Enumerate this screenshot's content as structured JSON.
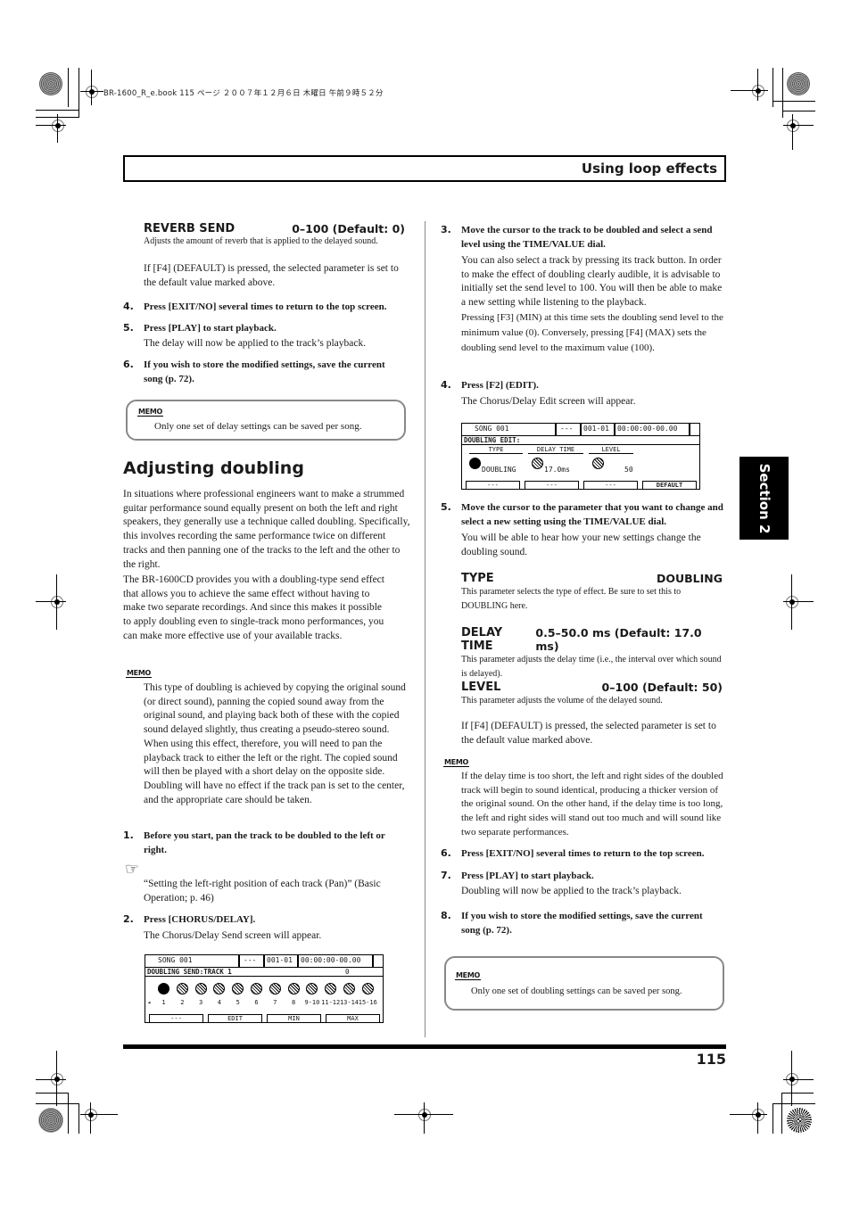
{
  "print_header": "BR-1600_R_e.book  115 ページ  ２００７年１２月６日  木曜日  午前９時５２分",
  "header": {
    "title": "Using loop effects"
  },
  "section_tab": "Section 2",
  "page_number": "115",
  "left": {
    "reverb_send": {
      "name": "REVERB SEND",
      "range": "0–100 (Default: 0)",
      "desc": "Adjusts the amount of reverb that is applied to the delayed sound."
    },
    "default_note": "If [F4] (DEFAULT) is pressed, the selected parameter is set to the default value marked above.",
    "steps_a": [
      {
        "num": "4.",
        "text": "Press [EXIT/NO] several times to return to the top screen.",
        "sub": ""
      },
      {
        "num": "5.",
        "text": "Press [PLAY] to start playback.",
        "sub": "The delay will now be applied to the track’s playback."
      },
      {
        "num": "6.",
        "text": "If you wish to store the modified settings, save the current song (p. 72).",
        "sub": ""
      }
    ],
    "memo1": {
      "icon": "MEMO",
      "text": "Only one set of delay settings can be saved per song."
    },
    "heading": "Adjusting doubling",
    "intro1": "In situations where professional engineers want to make a strummed guitar performance sound equally present on both the left and right speakers, they generally use a technique called doubling. Specifically, this involves recording the same performance twice on different tracks and then panning one of the tracks to the left and the other to the right.",
    "intro2": "The BR-1600CD provides you with a doubling-type send effect that allows you to achieve the same effect without having to make two separate recordings. And since this makes it possible to apply doubling even to single-track mono performances, you can make more effective use of your available tracks.",
    "memo2": {
      "icon": "MEMO",
      "text": "This type of doubling is achieved by copying the original sound (or direct sound), panning the copied sound away from the original sound, and playing back both of these with the copied sound delayed slightly, thus creating a pseudo-stereo sound. When using this effect, therefore, you will need to pan the playback track to either the left or the right. The copied sound will then be played with a short delay on the opposite side. Doubling will have no effect if the track pan is set to the center, and the appropriate care should be taken."
    },
    "step1": {
      "num": "1.",
      "text": "Before you start, pan the track to be doubled to the left or right."
    },
    "ref": {
      "icon": "☞",
      "text": "“Setting the left-right position of each track (Pan)” (Basic Operation; p. 46)"
    },
    "step2": {
      "num": "2.",
      "text": "Press [CHORUS/DELAY].",
      "sub": "The Chorus/Delay Send screen will appear."
    }
  },
  "screen_send": {
    "song": "SONG  001",
    "measure_blank": "---",
    "measure": "001-01",
    "time": "00:00:00-00.00",
    "title": "DOUBLING SEND:TRACK  1",
    "value": "0",
    "tracks": [
      "1",
      "2",
      "3",
      "4",
      "5",
      "6",
      "7",
      "8",
      "9-10",
      "11-12",
      "13-14",
      "15-16"
    ],
    "arrow": "◂",
    "fkeys": [
      "---",
      "EDIT",
      "MIN",
      "MAX"
    ]
  },
  "right": {
    "step3": {
      "num": "3.",
      "text": "Move the cursor to the track to be doubled and select a send level using the TIME/VALUE dial.",
      "sub1": "You can also select a track by pressing its track button. In order to make the effect of doubling clearly audible, it is advisable to initially set the send level to 100. You will then be able to make a new setting while listening to the playback.",
      "sub2": "Pressing [F3] (MIN) at this time sets the doubling send level to the minimum value (0). Conversely, pressing [F4] (MAX) sets the doubling send level to the maximum value (100)."
    },
    "step4": {
      "num": "4.",
      "text": "Press [F2] (EDIT).",
      "sub": "The Chorus/Delay Edit screen will appear."
    },
    "step5": {
      "num": "5.",
      "text": "Move the cursor to the parameter that you want to change and select a new setting using the TIME/VALUE dial.",
      "sub": "You will be able to hear how your new settings change the doubling sound."
    },
    "params": [
      {
        "name": "TYPE",
        "range": "DOUBLING",
        "desc": "This parameter selects the type of effect. Be sure to set this to DOUBLING here."
      },
      {
        "name": "DELAY TIME",
        "range": "0.5–50.0 ms (Default: 17.0 ms)",
        "desc": "This parameter adjusts the delay time (i.e., the interval over which sound is delayed)."
      },
      {
        "name": "LEVEL",
        "range": "0–100 (Default: 50)",
        "desc": "This parameter adjusts the volume of the delayed sound."
      }
    ],
    "default_note": "If [F4] (DEFAULT) is pressed, the selected parameter is set to the default value marked above.",
    "memo3": {
      "icon": "MEMO",
      "text": "If the delay time is too short, the left and right sides of the doubled track will begin to sound identical, producing a thicker version of the original sound. On the other hand, if the delay time is too long, the left and right sides will stand out too much and will sound like two separate performances."
    },
    "step6": {
      "num": "6.",
      "text": "Press [EXIT/NO] several times to return to the top screen."
    },
    "step7": {
      "num": "7.",
      "text": "Press [PLAY] to start playback.",
      "sub": "Doubling will now be applied to the track’s playback."
    },
    "step8": {
      "num": "8.",
      "text": "If you wish to store the modified settings, save the current song (p. 72)."
    },
    "memo4": {
      "icon": "MEMO",
      "text": "Only one set of doubling settings can be saved per song."
    }
  },
  "screen_edit": {
    "song": "SONG  001",
    "measure_blank": "---",
    "measure": "001-01",
    "time": "00:00:00-00.00",
    "title": "DOUBLING EDIT:",
    "cols": [
      {
        "label": "TYPE",
        "value": "DOUBLING"
      },
      {
        "label": "DELAY TIME",
        "value": "17.0ms"
      },
      {
        "label": "LEVEL",
        "value": "50"
      }
    ],
    "fkeys": [
      "---",
      "---",
      "---",
      "DEFAULT"
    ]
  }
}
